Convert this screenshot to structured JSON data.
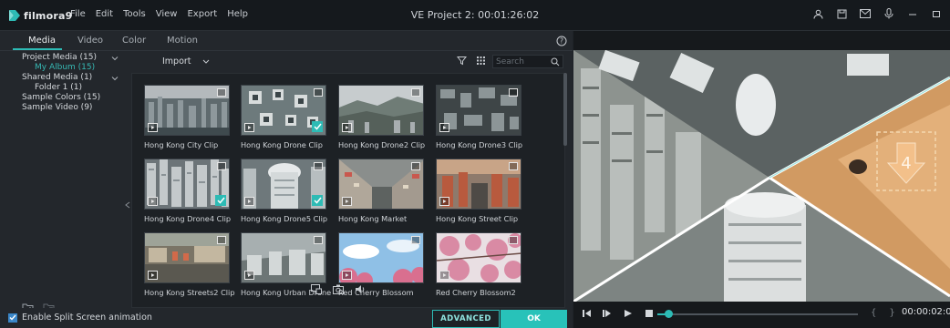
{
  "app": {
    "brand": "filmora9",
    "window_title": "VE Project 2: 00:01:26:02"
  },
  "menu": [
    "File",
    "Edit",
    "Tools",
    "View",
    "Export",
    "Help"
  ],
  "tabs": [
    "Media",
    "Video",
    "Color",
    "Motion"
  ],
  "library_tree": [
    {
      "label": "Project Media (15)",
      "expandable": true
    },
    {
      "label": "My Album (15)",
      "selected": true
    },
    {
      "label": "Shared Media (1)",
      "expandable": true
    },
    {
      "label": "Folder 1 (1)"
    },
    {
      "label": "Sample Colors (15)"
    },
    {
      "label": "Sample Video (9)"
    }
  ],
  "toolbar": {
    "import_label": "Import",
    "search_placeholder": "Search"
  },
  "media": [
    {
      "label": "Hong Kong City Clip",
      "checked": false
    },
    {
      "label": "Hong Kong Drone Clip",
      "checked": true
    },
    {
      "label": "Hong Kong Drone2 Clip",
      "checked": false
    },
    {
      "label": "Hong Kong Drone3 Clip",
      "checked": false
    },
    {
      "label": "Hong Kong Drone4 Clip",
      "checked": true
    },
    {
      "label": "Hong Kong Drone5 Clip",
      "checked": true
    },
    {
      "label": "Hong Kong Market",
      "checked": false
    },
    {
      "label": "Hong Kong Street Clip",
      "checked": false
    },
    {
      "label": "Hong Kong Streets2 Clip",
      "checked": false
    },
    {
      "label": "Hong Kong Urban Drone",
      "checked": false
    },
    {
      "label": "Red Cherry Blossom",
      "checked": false
    },
    {
      "label": "Red Cherry Blossom2",
      "checked": false
    }
  ],
  "footer": {
    "split_screen_label": "Enable Split Screen animation",
    "split_screen_checked": true,
    "advanced_label": "ADVANCED",
    "ok_label": "OK"
  },
  "preview": {
    "timecode": "00:00:02:0",
    "overlay_number": "4",
    "progress": 0.0
  },
  "colors": {
    "accent": "#2dbbb5",
    "ok": "#28c2b9",
    "background": "#1f2328"
  }
}
